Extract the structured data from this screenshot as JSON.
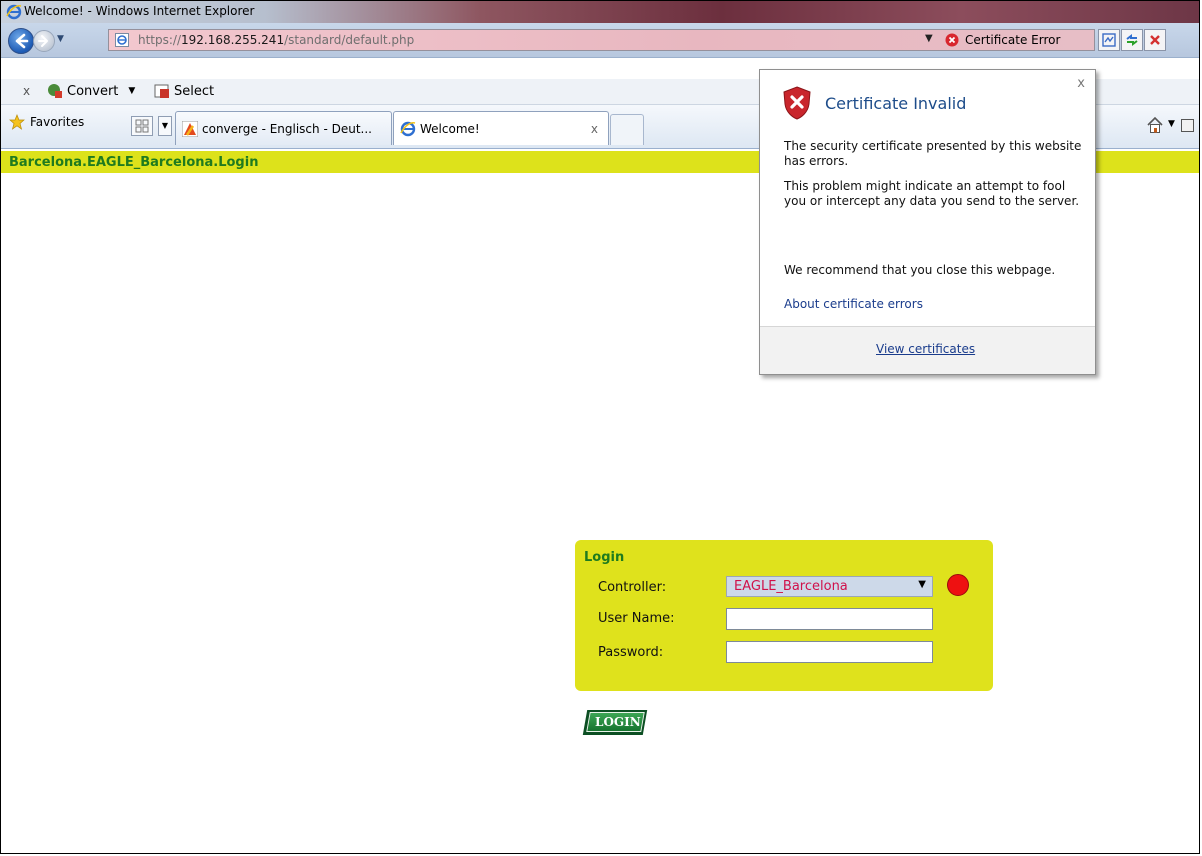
{
  "window": {
    "title": "Welcome! - Windows Internet Explorer"
  },
  "address_bar": {
    "url_prefix": "https://",
    "url_host": "192.168.255.241",
    "url_path": "/standard/default.php",
    "cert_status": "Certificate Error"
  },
  "command_bar": {
    "convert_label": "Convert",
    "select_label": "Select"
  },
  "tab_bar": {
    "favorites_label": "Favorites",
    "tabs": [
      {
        "label": "converge - Englisch - Deut..."
      },
      {
        "label": "Welcome!"
      }
    ]
  },
  "page": {
    "header": "Barcelona.EAGLE_Barcelona.Login",
    "login": {
      "title": "Login",
      "controller_label": "Controller:",
      "controller_value": "EAGLE_Barcelona",
      "username_label": "User Name:",
      "password_label": "Password:",
      "username_value": "",
      "password_value": "",
      "button_label": "LOGIN",
      "status_color": "#ee1111"
    }
  },
  "cert_popup": {
    "title": "Certificate Invalid",
    "p1": "The security certificate presented by this website has errors.",
    "p2": "This problem might indicate an attempt to fool you or intercept any data you send to the server.",
    "p3": "We recommend that you close this webpage.",
    "about_link": "About certificate errors",
    "view_link": "View certificates"
  },
  "icons": {
    "back": "back-arrow-icon",
    "forward": "forward-arrow-icon",
    "shield": "shield-error-icon",
    "home": "home-icon",
    "feeds": "feeds-icon",
    "favorites": "favorites-star-icon"
  }
}
